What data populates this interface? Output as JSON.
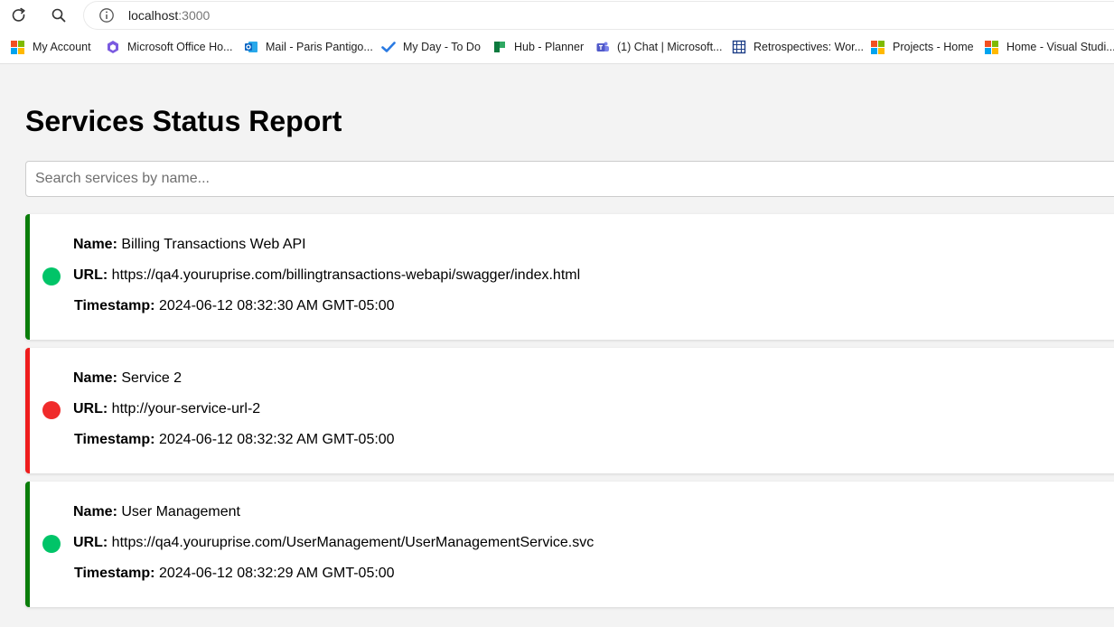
{
  "browser": {
    "address_host": "localhost",
    "address_port": ":3000",
    "bookmarks": [
      {
        "label": "My Account",
        "icon": "microsoft-logo-icon"
      },
      {
        "label": "Microsoft Office Ho...",
        "icon": "office-icon"
      },
      {
        "label": "Mail - Paris Pantigo...",
        "icon": "outlook-icon"
      },
      {
        "label": "My Day - To Do",
        "icon": "todo-check-icon"
      },
      {
        "label": "Hub - Planner",
        "icon": "planner-icon"
      },
      {
        "label": "(1) Chat | Microsoft...",
        "icon": "teams-icon"
      },
      {
        "label": "Retrospectives: Wor...",
        "icon": "grid-board-icon"
      },
      {
        "label": "Projects - Home",
        "icon": "microsoft-logo-icon"
      },
      {
        "label": "Home - Visual Studi...",
        "icon": "microsoft-logo-icon"
      }
    ]
  },
  "page": {
    "title": "Services Status Report",
    "search_placeholder": "Search services by name..."
  },
  "labels": {
    "name": "Name:",
    "url": "URL:",
    "timestamp": "Timestamp:"
  },
  "colors": {
    "status_up": "#00c468",
    "status_down": "#f02b2b",
    "border_up": "#0a7d0a",
    "border_down": "#ee1c1c"
  },
  "services": [
    {
      "name": "Billing Transactions Web API",
      "url": "https://qa4.youruprise.com/billingtransactions-webapi/swagger/index.html",
      "timestamp": "2024-06-12 08:32:30 AM GMT-05:00",
      "status": "up"
    },
    {
      "name": "Service 2",
      "url": "http://your-service-url-2",
      "timestamp": "2024-06-12 08:32:32 AM GMT-05:00",
      "status": "down"
    },
    {
      "name": "User Management",
      "url": "https://qa4.youruprise.com/UserManagement/UserManagementService.svc",
      "timestamp": "2024-06-12 08:32:29 AM GMT-05:00",
      "status": "up"
    }
  ]
}
